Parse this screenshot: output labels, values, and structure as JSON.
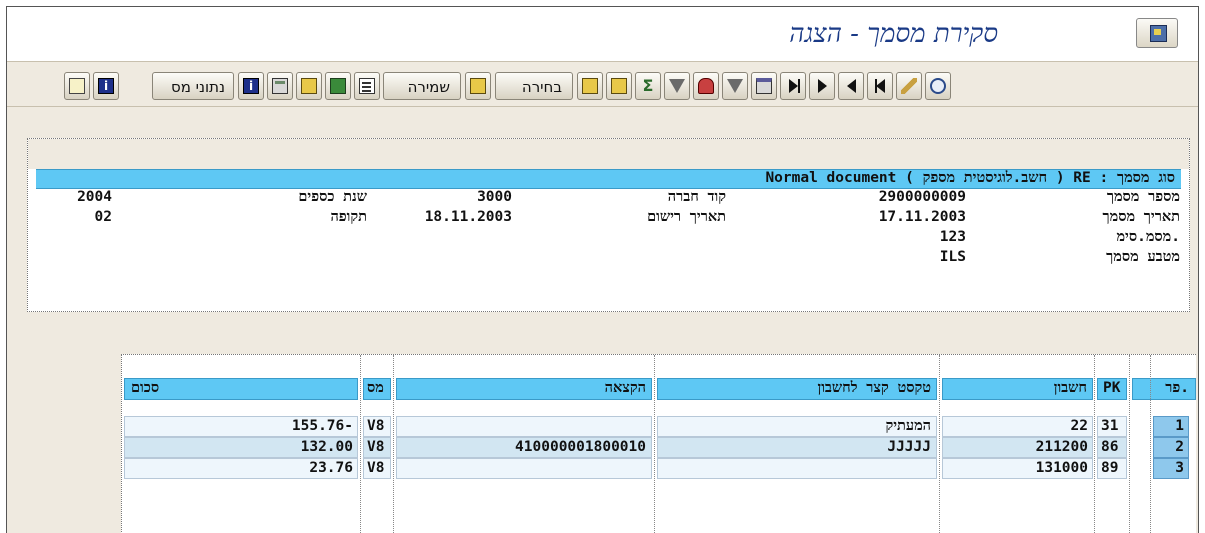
{
  "window": {
    "title": "סקירת מסמך - הצגה"
  },
  "toolbar": {
    "tax_data_label": "נתוני מס",
    "save_label": "שמירה",
    "select_label": "בחירה"
  },
  "header": {
    "doc_type_line": "סוג מסמך : RE ( חשב.לוגיסטית מספק ) Normal document",
    "rows": [
      {
        "label1": "מספר מסמך",
        "value1": "2900000009",
        "label2": "קוד חברה",
        "value2": "3000",
        "label3": "שנת כספים",
        "value3": "2004"
      },
      {
        "label1": "תאריך מסמך",
        "value1": "17.11.2003",
        "label2": "תאריך רישום",
        "value2": "18.11.2003",
        "label3": "תקופה",
        "value3": "02"
      },
      {
        "label1": "מסמ.סימ.",
        "value1": "123"
      },
      {
        "label1": "מטבע מסמך",
        "value1": "ILS"
      }
    ]
  },
  "table": {
    "columns": {
      "item": "פר.",
      "pk": "PK",
      "account": "חשבון",
      "short_text": "טקסט קצר לחשבון",
      "assignment": "הקצאה",
      "tax": "מס",
      "amount": "סכום"
    },
    "rows": [
      {
        "item": "1",
        "pk": "31",
        "account": "22",
        "short_text": "המעתיק",
        "assignment": "",
        "tax": "V8",
        "amount": "155.76-"
      },
      {
        "item": "2",
        "pk": "86",
        "account": "211200",
        "short_text": "JJJJJ",
        "assignment": "410000001800010",
        "tax": "V8",
        "amount": "132.00"
      },
      {
        "item": "3",
        "pk": "89",
        "account": "131000",
        "short_text": "",
        "assignment": "",
        "tax": "V8",
        "amount": "23.76"
      }
    ]
  }
}
